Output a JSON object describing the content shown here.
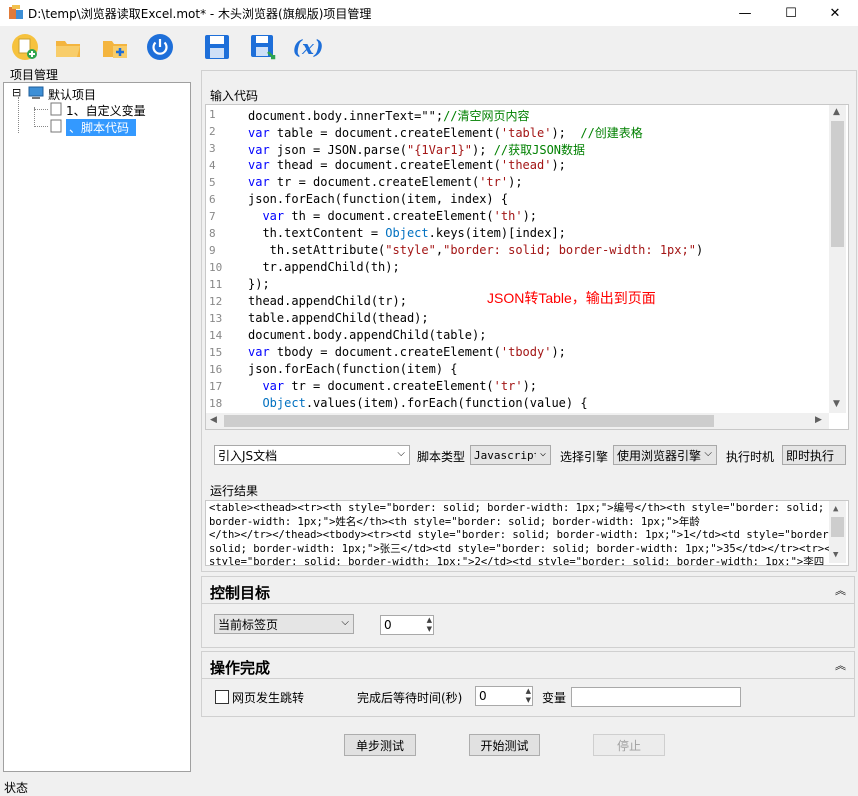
{
  "window": {
    "title": "D:\\temp\\浏览器读取Excel.mot* - 木头浏览器(旗舰版)项目管理",
    "minimize_label": "—",
    "maximize_label": "☐",
    "close_label": "✕"
  },
  "toolbar": {
    "icons": [
      "new-icon",
      "open-folder-icon",
      "add-folder-icon",
      "power-icon",
      "save-icon",
      "save-as-icon",
      "variable-x-icon"
    ],
    "variable_label": "(x)"
  },
  "project_panel": {
    "title": "项目管理",
    "tree_expander": "⊟",
    "root": "默认项目",
    "children": [
      "1、自定义变量",
      "、脚本代码"
    ]
  },
  "code_section": {
    "title": "输入代码",
    "annotation": "JSON转Table，输出到页面",
    "lines": [
      {
        "n": "1",
        "segs": [
          [
            "",
            "document.body.innerText=\"\";"
          ],
          [
            "cm",
            "//清空网页内容"
          ]
        ]
      },
      {
        "n": "2",
        "segs": [
          [
            "kw",
            "var"
          ],
          [
            "",
            " table = document.createElement("
          ],
          [
            "str",
            "'table'"
          ],
          [
            "",
            ");  "
          ],
          [
            "cm",
            "//创建表格"
          ]
        ]
      },
      {
        "n": "3",
        "segs": [
          [
            "kw",
            "var"
          ],
          [
            "",
            " json = JSON.parse("
          ],
          [
            "str",
            "\"{1Var1}\""
          ],
          [
            "",
            "); "
          ],
          [
            "cm",
            "//获取JSON数据"
          ]
        ]
      },
      {
        "n": "4",
        "segs": [
          [
            "kw",
            "var"
          ],
          [
            "",
            " thead = document.createElement("
          ],
          [
            "str",
            "'thead'"
          ],
          [
            "",
            ");"
          ]
        ]
      },
      {
        "n": "5",
        "segs": [
          [
            "kw",
            "var"
          ],
          [
            "",
            " tr = document.createElement("
          ],
          [
            "str",
            "'tr'"
          ],
          [
            "",
            ");"
          ]
        ]
      },
      {
        "n": "6",
        "segs": [
          [
            "",
            "json.forEach(function(item, index) {"
          ]
        ]
      },
      {
        "n": "7",
        "segs": [
          [
            "",
            "  "
          ],
          [
            "kw",
            "var"
          ],
          [
            "",
            " th = document.createElement("
          ],
          [
            "str",
            "'th'"
          ],
          [
            "",
            ");"
          ]
        ]
      },
      {
        "n": "8",
        "segs": [
          [
            "",
            "  th.textContent = "
          ],
          [
            "ob",
            "Object"
          ],
          [
            "",
            ".keys(item)[index];"
          ]
        ]
      },
      {
        "n": "9",
        "segs": [
          [
            "",
            "   th.setAttribute("
          ],
          [
            "str",
            "\"style\""
          ],
          [
            "",
            ","
          ],
          [
            "str",
            "\"border: solid; border-width: 1px;\""
          ],
          [
            "",
            ")"
          ]
        ]
      },
      {
        "n": "10",
        "segs": [
          [
            "",
            "  tr.appendChild(th);"
          ]
        ]
      },
      {
        "n": "11",
        "segs": [
          [
            "",
            "});"
          ]
        ]
      },
      {
        "n": "12",
        "segs": [
          [
            "",
            "thead.appendChild(tr);"
          ]
        ]
      },
      {
        "n": "13",
        "segs": [
          [
            "",
            "table.appendChild(thead);"
          ]
        ]
      },
      {
        "n": "14",
        "segs": [
          [
            "",
            "document.body.appendChild(table);"
          ]
        ]
      },
      {
        "n": "15",
        "segs": [
          [
            "kw",
            "var"
          ],
          [
            "",
            " tbody = document.createElement("
          ],
          [
            "str",
            "'tbody'"
          ],
          [
            "",
            ");"
          ]
        ]
      },
      {
        "n": "16",
        "segs": [
          [
            "",
            "json.forEach(function(item) {"
          ]
        ]
      },
      {
        "n": "17",
        "segs": [
          [
            "",
            "  "
          ],
          [
            "kw",
            "var"
          ],
          [
            "",
            " tr = document.createElement("
          ],
          [
            "str",
            "'tr'"
          ],
          [
            "",
            ");"
          ]
        ]
      },
      {
        "n": "18",
        "segs": [
          [
            "",
            "  "
          ],
          [
            "ob",
            "Object"
          ],
          [
            "",
            ".values(item).forEach(function(value) {"
          ]
        ]
      }
    ]
  },
  "script_options": {
    "import_js": "引入JS文档",
    "script_type_label": "脚本类型",
    "script_type_value": "Javascript",
    "engine_label": "选择引擎",
    "engine_value": "使用浏览器引擎",
    "timing_label": "执行时机",
    "timing_value": "即时执行"
  },
  "result_section": {
    "title": "运行结果",
    "lines": [
      "<table><thead><tr><th style=\"border: solid; border-width: 1px;\">编号</th><th style=\"border: solid;",
      "border-width: 1px;\">姓名</th><th style=\"border: solid; border-width: 1px;\">年龄",
      "</th></tr></thead><tbody><tr><td style=\"border: solid; border-width: 1px;\">1</td><td style=\"border:",
      "solid; border-width: 1px;\">张三</td><td style=\"border: solid; border-width: 1px;\">35</td></tr><tr><td",
      "style=\"border: solid; border-width: 1px;\">2</td><td style=\"border: solid; border-width: 1px;\">李四"
    ]
  },
  "control_target": {
    "title": "控制目标",
    "collapse_icon": "︽",
    "tab_select": "当前标签页",
    "index_value": "0"
  },
  "operation_done": {
    "title": "操作完成",
    "collapse_icon": "︽",
    "redirect_label": "网页发生跳转",
    "wait_label": "完成后等待时间(秒)",
    "wait_value": "0",
    "variable_label": "变量",
    "variable_value": ""
  },
  "buttons": {
    "step_test": "单步测试",
    "start_test": "开始测试",
    "stop": "停止"
  },
  "status": {
    "text": "状态"
  }
}
